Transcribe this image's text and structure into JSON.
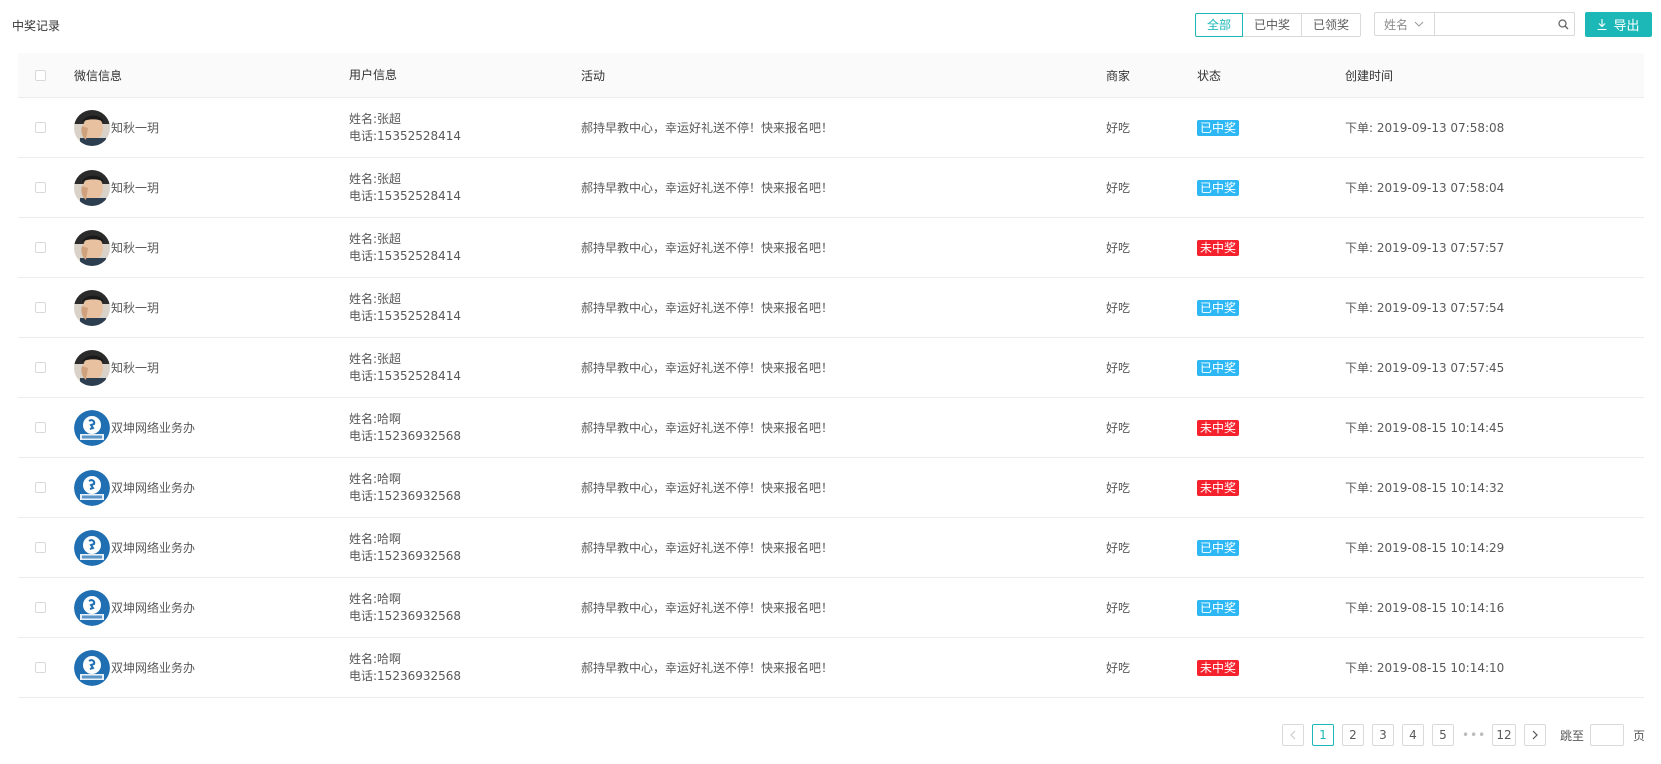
{
  "page": {
    "title": "中奖记录"
  },
  "filters": [
    "全部",
    "已中奖",
    "已领奖"
  ],
  "search": {
    "field": "姓名",
    "value": ""
  },
  "export_label": "导出",
  "columns": [
    "微信信息",
    "用户信息",
    "活动",
    "商家",
    "状态",
    "创建时间"
  ],
  "rows": [
    {
      "wx_name": "知秋一玥",
      "avatar": "avatar-a",
      "name": "姓名:张超",
      "phone": "电话:15352528414",
      "activity": "郝持早教中心，幸运好礼送不停！快来报名吧！",
      "shop": "好吃",
      "status": "已中奖",
      "status_type": "won",
      "time": "下单: 2019-09-13 07:58:08"
    },
    {
      "wx_name": "知秋一玥",
      "avatar": "avatar-a",
      "name": "姓名:张超",
      "phone": "电话:15352528414",
      "activity": "郝持早教中心，幸运好礼送不停！快来报名吧！",
      "shop": "好吃",
      "status": "已中奖",
      "status_type": "won",
      "time": "下单: 2019-09-13 07:58:04"
    },
    {
      "wx_name": "知秋一玥",
      "avatar": "avatar-a",
      "name": "姓名:张超",
      "phone": "电话:15352528414",
      "activity": "郝持早教中心，幸运好礼送不停！快来报名吧！",
      "shop": "好吃",
      "status": "未中奖",
      "status_type": "lost",
      "time": "下单: 2019-09-13 07:57:57"
    },
    {
      "wx_name": "知秋一玥",
      "avatar": "avatar-a",
      "name": "姓名:张超",
      "phone": "电话:15352528414",
      "activity": "郝持早教中心，幸运好礼送不停！快来报名吧！",
      "shop": "好吃",
      "status": "已中奖",
      "status_type": "won",
      "time": "下单: 2019-09-13 07:57:54"
    },
    {
      "wx_name": "知秋一玥",
      "avatar": "avatar-a",
      "name": "姓名:张超",
      "phone": "电话:15352528414",
      "activity": "郝持早教中心，幸运好礼送不停！快来报名吧！",
      "shop": "好吃",
      "status": "已中奖",
      "status_type": "won",
      "time": "下单: 2019-09-13 07:57:45"
    },
    {
      "wx_name": "双坤网络业务办",
      "avatar": "avatar-b",
      "name": "姓名:哈啊",
      "phone": "电话:15236932568",
      "activity": "郝持早教中心，幸运好礼送不停！快来报名吧！",
      "shop": "好吃",
      "status": "未中奖",
      "status_type": "lost",
      "time": "下单: 2019-08-15 10:14:45"
    },
    {
      "wx_name": "双坤网络业务办",
      "avatar": "avatar-b",
      "name": "姓名:哈啊",
      "phone": "电话:15236932568",
      "activity": "郝持早教中心，幸运好礼送不停！快来报名吧！",
      "shop": "好吃",
      "status": "未中奖",
      "status_type": "lost",
      "time": "下单: 2019-08-15 10:14:32"
    },
    {
      "wx_name": "双坤网络业务办",
      "avatar": "avatar-b",
      "name": "姓名:哈啊",
      "phone": "电话:15236932568",
      "activity": "郝持早教中心，幸运好礼送不停！快来报名吧！",
      "shop": "好吃",
      "status": "已中奖",
      "status_type": "won",
      "time": "下单: 2019-08-15 10:14:29"
    },
    {
      "wx_name": "双坤网络业务办",
      "avatar": "avatar-b",
      "name": "姓名:哈啊",
      "phone": "电话:15236932568",
      "activity": "郝持早教中心，幸运好礼送不停！快来报名吧！",
      "shop": "好吃",
      "status": "已中奖",
      "status_type": "won",
      "time": "下单: 2019-08-15 10:14:16"
    },
    {
      "wx_name": "双坤网络业务办",
      "avatar": "avatar-b",
      "name": "姓名:哈啊",
      "phone": "电话:15236932568",
      "activity": "郝持早教中心，幸运好礼送不停！快来报名吧！",
      "shop": "好吃",
      "status": "未中奖",
      "status_type": "lost",
      "time": "下单: 2019-08-15 10:14:10"
    }
  ],
  "pagination": {
    "pages": [
      "1",
      "2",
      "3",
      "4",
      "5"
    ],
    "ellipsis": "•••",
    "last": "12",
    "current": "1",
    "jump_label": "跳至",
    "jump_unit": "页"
  },
  "colors": {
    "accent": "#1cb8b8",
    "won": "#2db7f5",
    "lost": "#f5222d"
  }
}
